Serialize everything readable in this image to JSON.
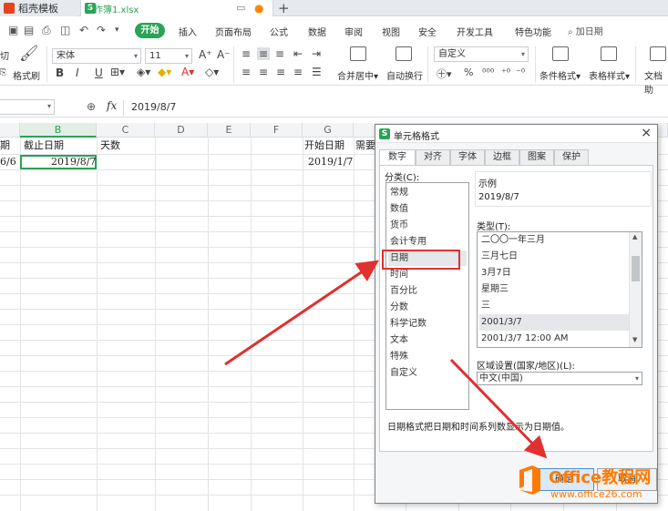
{
  "tabs": [
    {
      "label": "稻壳模板"
    },
    {
      "label": "工作簿1.xlsx"
    }
  ],
  "menu": {
    "start": "开始",
    "items": [
      "插入",
      "页面布局",
      "公式",
      "数据",
      "审阅",
      "视图",
      "安全",
      "开发工具",
      "特色功能"
    ],
    "search": "加日期"
  },
  "ribbon": {
    "cut": "切",
    "format_painter": "格式刷",
    "font_name": "宋体",
    "font_size": "11",
    "bold": "B",
    "italic": "I",
    "underline": "U",
    "merge_center": "合并居中",
    "wrap_text": "自动换行",
    "number_format": "自定义",
    "cond_format": "条件格式",
    "table_style": "表格样式",
    "doc_assist": "文档助"
  },
  "formula_bar": {
    "fx": "fx",
    "value": "2019/8/7"
  },
  "grid": {
    "columns": [
      "B",
      "C",
      "D",
      "E",
      "F",
      "G"
    ],
    "header_row": {
      "a_tail": "期",
      "b": "截止日期",
      "c": "天数",
      "g": "开始日期",
      "h_tail": "需要"
    },
    "row2": {
      "a_tail": "6/6",
      "b": "2019/8/7",
      "g": "2019/1/7"
    }
  },
  "dialog": {
    "title": "单元格格式",
    "tabs": [
      "数字",
      "对齐",
      "字体",
      "边框",
      "图案",
      "保护"
    ],
    "category_label": "分类(C):",
    "categories": [
      "常规",
      "数值",
      "货币",
      "会计专用",
      "日期",
      "时间",
      "百分比",
      "分数",
      "科学记数",
      "文本",
      "特殊",
      "自定义"
    ],
    "selected_category": "日期",
    "sample_label": "示例",
    "sample_value": "2019/8/7",
    "type_label": "类型(T):",
    "types": [
      "二〇〇一年三月",
      "三月七日",
      "3月7日",
      "星期三",
      "三",
      "2001/3/7",
      "2001/3/7 12:00 AM"
    ],
    "selected_type": "2001/3/7",
    "locale_label": "区域设置(国家/地区)(L):",
    "locale_value": "中文(中国)",
    "description": "日期格式把日期和时间系列数显示为日期值。",
    "ok": "确定",
    "cancel": "取消"
  },
  "watermark": {
    "brand": "Office教程网",
    "url": "www.office26.com"
  },
  "colors": {
    "accent": "#2aa356",
    "annotation": "#e0302f",
    "watermark": "#ff7a00"
  }
}
